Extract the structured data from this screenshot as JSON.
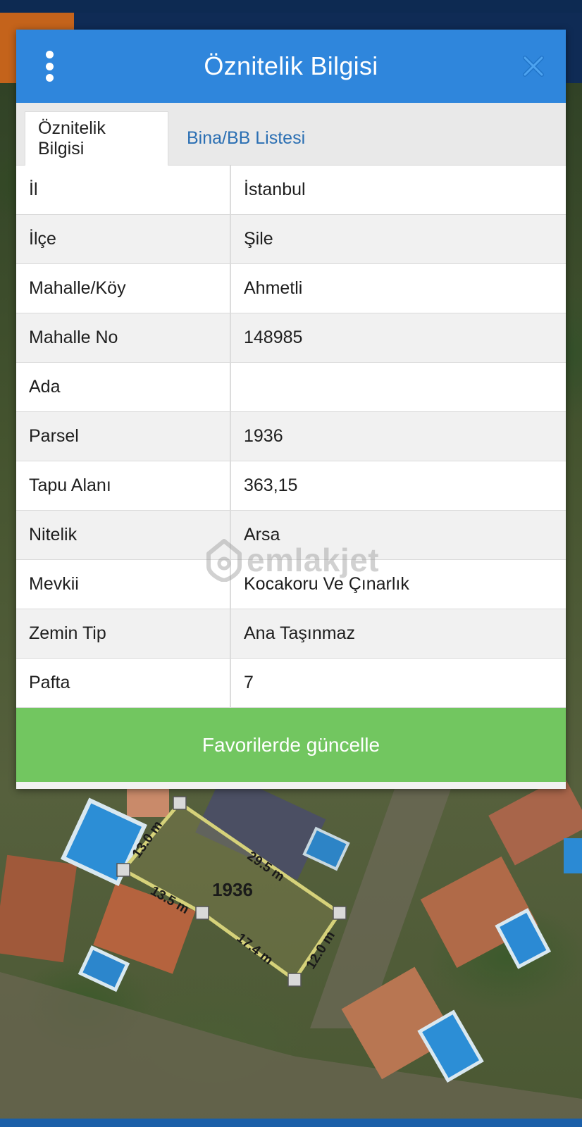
{
  "modal": {
    "title": "Öznitelik Bilgisi",
    "tabs": [
      {
        "label": "Öznitelik Bilgisi",
        "active": true
      },
      {
        "label": "Bina/BB Listesi",
        "active": false
      }
    ],
    "rows": [
      {
        "key": "İl",
        "value": "İstanbul"
      },
      {
        "key": "İlçe",
        "value": "Şile"
      },
      {
        "key": "Mahalle/Köy",
        "value": "Ahmetli"
      },
      {
        "key": "Mahalle No",
        "value": "148985"
      },
      {
        "key": "Ada",
        "value": ""
      },
      {
        "key": "Parsel",
        "value": "1936"
      },
      {
        "key": "Tapu Alanı",
        "value": "363,15"
      },
      {
        "key": "Nitelik",
        "value": "Arsa"
      },
      {
        "key": "Mevkii",
        "value": "Kocakoru Ve Çınarlık"
      },
      {
        "key": "Zemin Tip",
        "value": "Ana Taşınmaz"
      },
      {
        "key": "Pafta",
        "value": "7"
      }
    ],
    "favorite_button": "Favorilerde güncelle"
  },
  "watermark": "emlakjet",
  "map": {
    "parcel_number": "1936",
    "dimensions": [
      "13.0 m",
      "29.5 m",
      "13.5 m",
      "17.4 m",
      "12.0 m"
    ]
  },
  "colors": {
    "header": "#2f86dc",
    "accent_green": "#72c660",
    "tab_link": "#2b6fb3",
    "parcel_outline": "#d6d27a"
  }
}
